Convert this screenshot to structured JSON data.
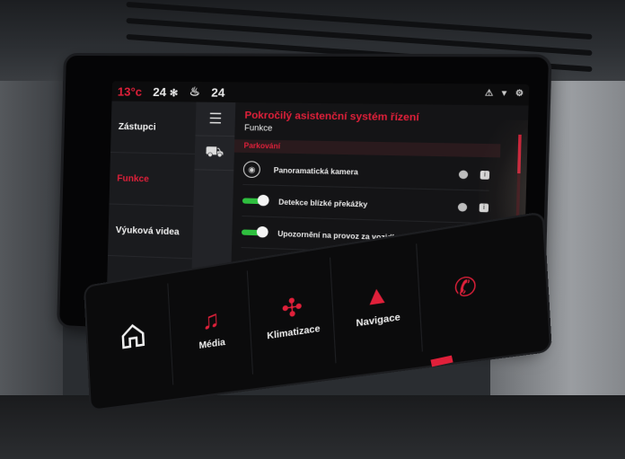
{
  "status": {
    "temp_left": "13°c",
    "fan_left": "24",
    "fan_right": "24",
    "icons_right": "⚠ ▾ ⚙"
  },
  "left_menu": {
    "items": [
      {
        "label": "Zástupci",
        "active": false
      },
      {
        "label": "Funkce",
        "active": true
      },
      {
        "label": "Výuková videa",
        "active": false
      }
    ]
  },
  "content": {
    "title": "Pokročilý asistenční systém řízení",
    "subtitle": "Funkce",
    "section": "Parkování",
    "rows": [
      {
        "label": "Panoramatická kamera",
        "type": "icon"
      },
      {
        "label": "Detekce blízké překážky",
        "type": "toggle"
      },
      {
        "label": "Upozornění na provoz za vozidlem",
        "type": "toggle"
      }
    ]
  },
  "buttons": [
    {
      "label": "",
      "icon": "home-icon"
    },
    {
      "label": "Média",
      "icon": "music-icon"
    },
    {
      "label": "Klimatizace",
      "icon": "fan-icon"
    },
    {
      "label": "Navigace",
      "icon": "navigation-arrow-icon"
    },
    {
      "label": "",
      "icon": "phone-icon"
    }
  ],
  "colors": {
    "accent": "#e0203a",
    "toggle_on": "#2fbf3f"
  }
}
